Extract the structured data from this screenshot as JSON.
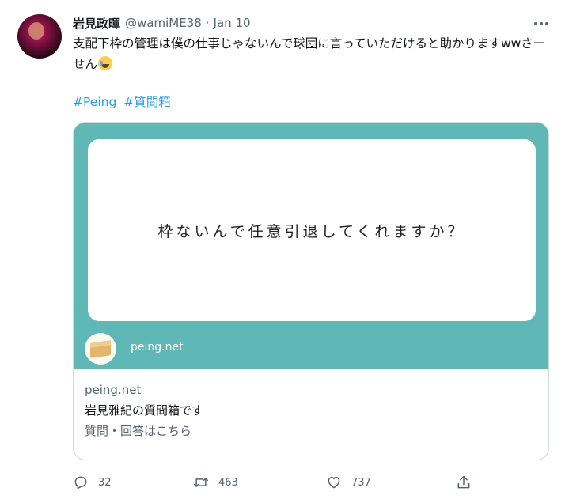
{
  "tweet": {
    "author": {
      "display_name": "岩見政暉",
      "handle": "@wamiME38",
      "separator": "·",
      "date": "Jan 10"
    },
    "text": "支配下枠の管理は僕の仕事じゃないんで球団に言っていただけると助かりますwwさーせん",
    "emoji": "face-with-tears-of-joy",
    "hashtags": [
      "#Peing",
      "#質問箱"
    ],
    "card": {
      "image_question": "枠ないんで任意引退してくれますか？",
      "image_site": "peing.net",
      "domain": "peing.net",
      "title": "岩見雅紀の質問箱です",
      "description": "質問・回答はこちら",
      "colors": {
        "image_background": "#5fb7b6",
        "panel": "#ffffff"
      }
    },
    "actions": {
      "replies": "32",
      "retweets": "463",
      "likes": "737"
    }
  },
  "colors": {
    "text": "#0f1419",
    "secondary": "#536471",
    "link": "#1d9bf0",
    "border": "#cfd9de"
  }
}
